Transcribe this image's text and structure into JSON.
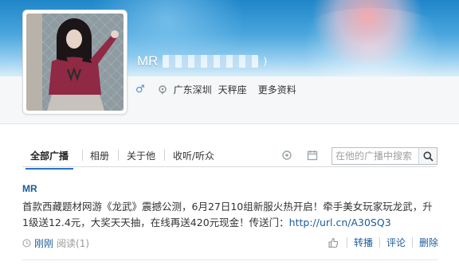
{
  "profile": {
    "name": "MR",
    "handle_suffix": ")",
    "location": "广东深圳",
    "constellation": "天秤座",
    "more_info": "更多资料",
    "gender_icon": "male-icon",
    "location_icon": "pin-icon"
  },
  "tabs": [
    {
      "label": "全部广播",
      "active": true
    },
    {
      "label": "相册",
      "active": false
    },
    {
      "label": "关于他",
      "active": false
    },
    {
      "label": "收听/听众",
      "active": false
    }
  ],
  "search": {
    "placeholder": "在他的广播中搜索",
    "icon": "search-icon"
  },
  "post": {
    "author": "MR",
    "text_main": "首款西藏题材网游《龙武》震撼公测，6月27日10组新服火热开启！牵手美女玩家玩龙武，升1级送12.4元，大奖天天抽，在线再送420元现金！传送门：",
    "link": "http://url.cn/A30SQ3",
    "time": "刚刚",
    "reads": "阅读(1)",
    "actions": [
      "转播",
      "评论",
      "删除"
    ]
  },
  "colors": {
    "accent": "#1d5b9c",
    "tab_active": "#2b74c0",
    "banner_top": "#1f86c9"
  }
}
